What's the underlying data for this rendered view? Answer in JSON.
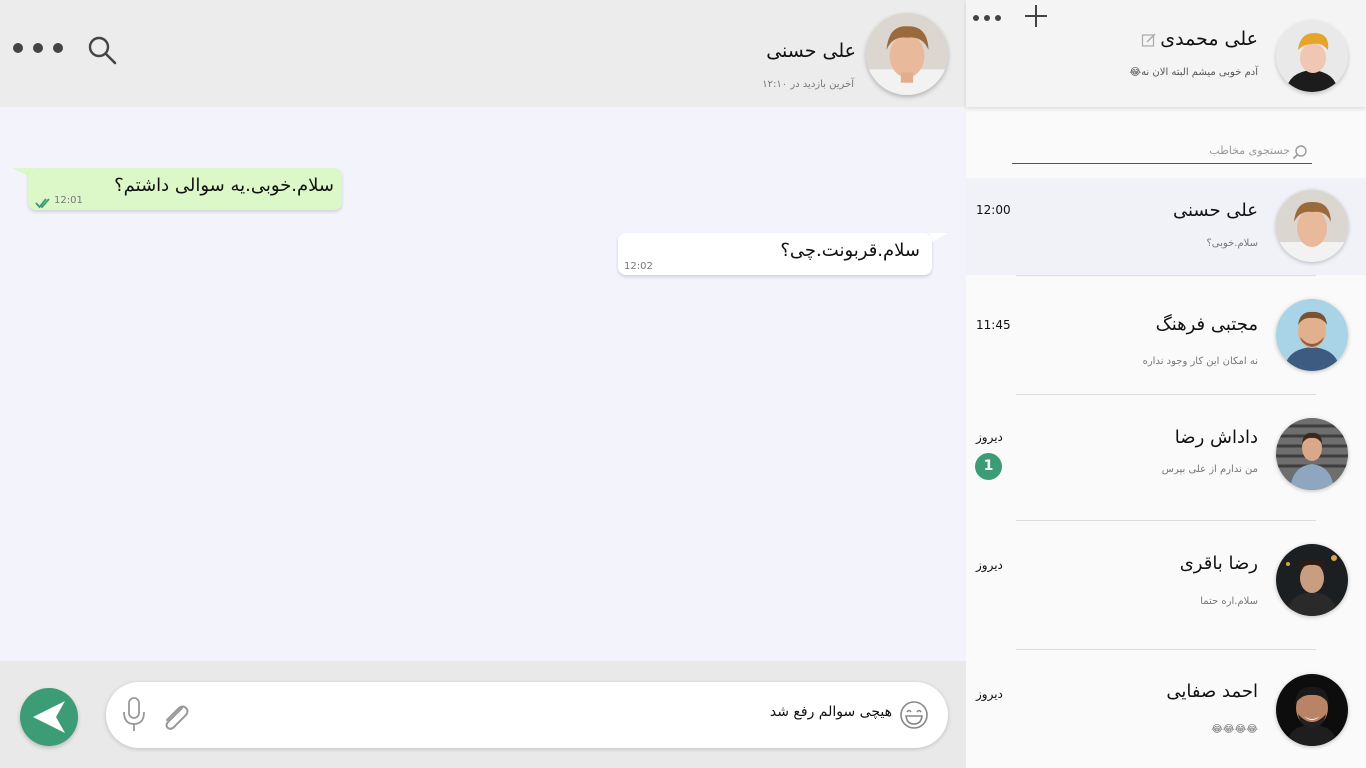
{
  "colors": {
    "accent": "#3b9c75",
    "incoming_bubble": "#dcf8c8",
    "outgoing_bubble": "#ffffff",
    "chat_bg": "#f3f3fb"
  },
  "chat": {
    "contact_name": "علی حسنی",
    "last_seen": "آخرین بازدید در ۱۲:۱۰",
    "messages": [
      {
        "text": "سلام.خوبی.یه سوالی داشتم؟",
        "time": "12:01",
        "direction": "in",
        "read": true
      },
      {
        "text": "سلام.قربونت.چی؟",
        "time": "12:02",
        "direction": "out"
      }
    ],
    "composer": {
      "value": "هیچی سوالم رفع شد"
    },
    "icons": {
      "search": "search-icon",
      "menu": "more-icon",
      "emoji": "emoji-icon",
      "attach": "paperclip-icon",
      "mic": "microphone-icon",
      "send": "send-icon"
    }
  },
  "sidebar": {
    "profile": {
      "name": "علی محمدی",
      "status": "آدم خوبی میشم البته الان نه😂"
    },
    "search": {
      "placeholder": "جستجوی مخاطب"
    },
    "conversations": [
      {
        "name": "علی حسنی",
        "preview": "سلام.خوبی؟",
        "time": "12:00",
        "active": true
      },
      {
        "name": "مجتبی فرهنگ",
        "preview": "نه امکان این کار وجود نداره",
        "time": "11:45"
      },
      {
        "name": "داداش رضا",
        "preview": "من ندارم از علی بپرس",
        "time": "دیروز",
        "unread": "1"
      },
      {
        "name": "رضا باقری",
        "preview": "سلام.اره حتما",
        "time": "دیروز"
      },
      {
        "name": "احمد صفایی",
        "preview": "😂😂😂😂",
        "time": "دیروز"
      }
    ]
  }
}
